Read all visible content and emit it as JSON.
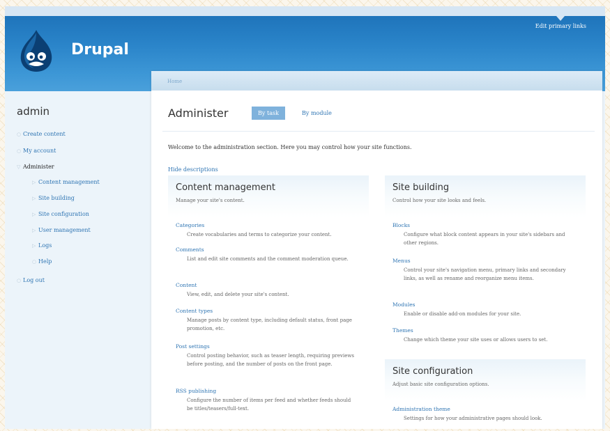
{
  "colors": {
    "accent": "#2f75b3",
    "header": "#2a84c9",
    "tab_active": "#7fb2dc"
  },
  "header": {
    "site_name": "Drupal",
    "primary_links": "Edit primary links",
    "logo_icon": "drupal-drop-icon"
  },
  "breadcrumb": {
    "home": "Home"
  },
  "sidebar": {
    "title": "admin",
    "items": [
      {
        "label": "Create content"
      },
      {
        "label": "My account"
      },
      {
        "label": "Administer"
      },
      {
        "label": "Content management"
      },
      {
        "label": "Site building"
      },
      {
        "label": "Site configuration"
      },
      {
        "label": "User management"
      },
      {
        "label": "Logs"
      },
      {
        "label": "Help"
      },
      {
        "label": "Log out"
      }
    ]
  },
  "main": {
    "title": "Administer",
    "tabs": [
      {
        "label": "By task"
      },
      {
        "label": "By module"
      }
    ],
    "intro": "Welcome to the administration section. Here you may control how your site functions.",
    "hide_descriptions": "Hide descriptions",
    "panels": {
      "content_management": {
        "title": "Content management",
        "description": "Manage your site's content.",
        "items": [
          {
            "title": "Categories",
            "description": "Create vocabularies and terms to categorize your content."
          },
          {
            "title": "Comments",
            "description": "List and edit site comments and the comment moderation queue."
          },
          {
            "title": "Content",
            "description": "View, edit, and delete your site's content."
          },
          {
            "title": "Content types",
            "description": "Manage posts by content type, including default status, front page promotion, etc."
          },
          {
            "title": "Post settings",
            "description": "Control posting behavior, such as teaser length, requiring previews before posting, and the number of posts on the front page."
          },
          {
            "title": "RSS publishing",
            "description": "Configure the number of items per feed and whether feeds should be titles/teasers/full-text."
          }
        ]
      },
      "site_building": {
        "title": "Site building",
        "description": "Control how your site looks and feels.",
        "items": [
          {
            "title": "Blocks",
            "description": "Configure what block content appears in your site's sidebars and other regions."
          },
          {
            "title": "Menus",
            "description": "Control your site's navigation menu, primary links and secondary links, as well as rename and reorganize menu items."
          },
          {
            "title": "Modules",
            "description": "Enable or disable add-on modules for your site."
          },
          {
            "title": "Themes",
            "description": "Change which theme your site uses or allows users to set."
          }
        ]
      },
      "site_configuration": {
        "title": "Site configuration",
        "description": "Adjust basic site configuration options.",
        "items": [
          {
            "title": "Administration theme",
            "description": "Settings for how your administrative pages should look."
          }
        ]
      }
    }
  }
}
